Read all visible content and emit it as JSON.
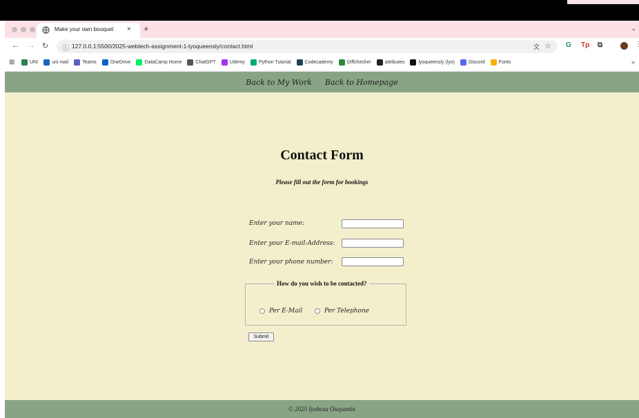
{
  "browser": {
    "tab_title": "Make your own bouquet",
    "tab_close": "×",
    "new_tab": "+",
    "url": "127.0.0.1:5500/2025-webtech-assignment-1-lyoqueensly/contact.html",
    "bookmarks": [
      {
        "label": "UNI",
        "color": "#2e7d4f"
      },
      {
        "label": "uni mail",
        "color": "#1565c0"
      },
      {
        "label": "Teams",
        "color": "#5b5fc7"
      },
      {
        "label": "OneDrive",
        "color": "#0a64c8"
      },
      {
        "label": "DataCamp Home",
        "color": "#03ef62"
      },
      {
        "label": "ChatGPT",
        "color": "#555555"
      },
      {
        "label": "Udemy",
        "color": "#a435f0"
      },
      {
        "label": "Python Tutorial",
        "color": "#04aa6d"
      },
      {
        "label": "Codecademy",
        "color": "#1f4056"
      },
      {
        "label": "Diffchecker",
        "color": "#2a8c3a"
      },
      {
        "label": "attributes",
        "color": "#222222"
      },
      {
        "label": "lyoqueensly (lyo)",
        "color": "#111111"
      },
      {
        "label": "Discord",
        "color": "#5865f2"
      },
      {
        "label": "Fonts",
        "color": "#f4b400"
      }
    ],
    "bookmarks_more": "»"
  },
  "nav": {
    "work_label": "Back to My Work",
    "home_label": "Back to Homepage"
  },
  "form": {
    "title": "Contact Form",
    "subtitle": "Please fill out the form for bookings",
    "name_label": "Enter your name:",
    "email_label": "Enter your E-mail-Address:",
    "phone_label": "Enter your phone number:",
    "name_value": "",
    "email_value": "",
    "phone_value": "",
    "legend": "How do you wish to be contacted?",
    "option_email": "Per E-Mail",
    "option_phone": "Per Telephone",
    "submit_label": "Submit"
  },
  "footer": {
    "text": "© 2025 Iyobosa Osayantin"
  },
  "colors": {
    "page_bg": "#f3efcc",
    "nav_bg": "#88a484",
    "tabstrip_bg": "#fbe1e6"
  }
}
